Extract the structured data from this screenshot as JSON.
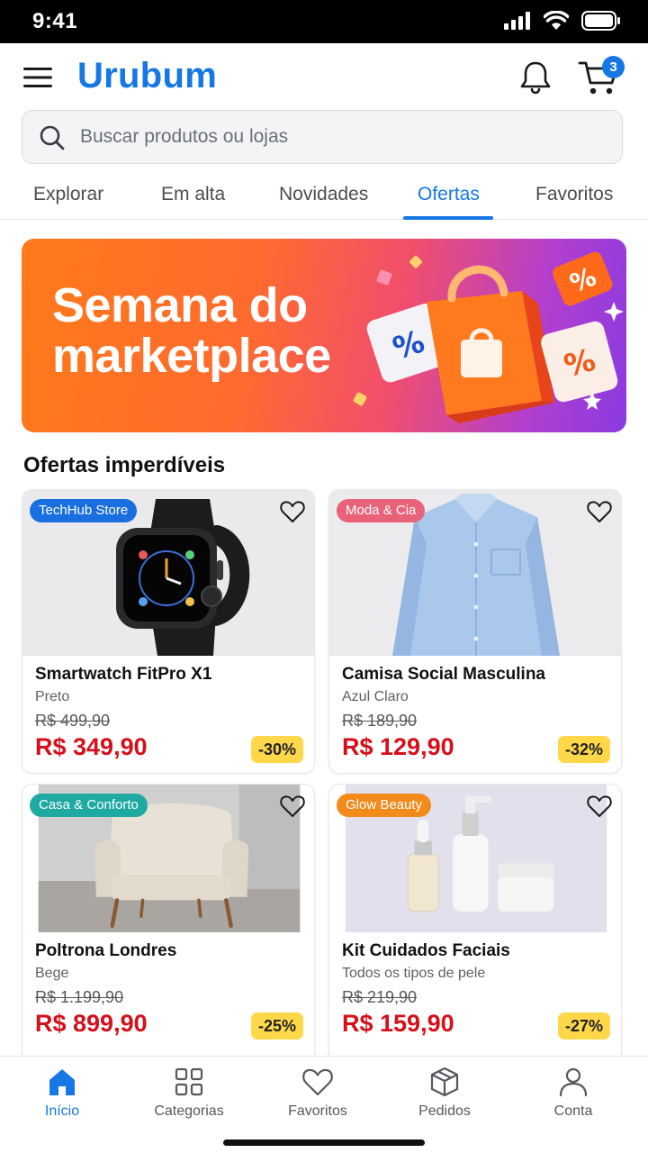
{
  "status_bar": {
    "time": "9:41"
  },
  "header": {
    "brand": "Urubum",
    "cart_count": "3"
  },
  "search": {
    "placeholder": "Buscar produtos ou lojas"
  },
  "tabs": [
    {
      "label": "Explorar"
    },
    {
      "label": "Em alta"
    },
    {
      "label": "Novidades"
    },
    {
      "label": "Ofertas",
      "active": true
    },
    {
      "label": "Favoritos"
    }
  ],
  "banner": {
    "title": "Semana do marketplace"
  },
  "section": {
    "title": "Ofertas imperdíveis"
  },
  "products": [
    {
      "store": "TechHub Store",
      "store_color": "#1a6fe0",
      "name": "Smartwatch FitPro X1",
      "variant": "Preto",
      "old_price": "R$ 499,90",
      "price": "R$ 349,90",
      "discount": "-30%"
    },
    {
      "store": "Moda & Cia",
      "store_color": "#e8637a",
      "name": "Camisa Social Masculina",
      "variant": "Azul Claro",
      "old_price": "R$ 189,90",
      "price": "R$ 129,90",
      "discount": "-32%"
    },
    {
      "store": "Casa & Conforto",
      "store_color": "#1fa9a3",
      "name": "Poltrona Londres",
      "variant": "Bege",
      "old_price": "R$ 1.199,90",
      "price": "R$ 899,90",
      "discount": "-25%"
    },
    {
      "store": "Glow Beauty",
      "store_color": "#f28a1c",
      "name": "Kit Cuidados Faciais",
      "variant": "Todos os tipos de pele",
      "old_price": "R$ 219,90",
      "price": "R$ 159,90",
      "discount": "-27%"
    }
  ],
  "bottom_nav": [
    {
      "label": "Início",
      "icon": "home-icon",
      "active": true
    },
    {
      "label": "Categorias",
      "icon": "grid-icon"
    },
    {
      "label": "Favoritos",
      "icon": "heart-icon"
    },
    {
      "label": "Pedidos",
      "icon": "box-icon"
    },
    {
      "label": "Conta",
      "icon": "user-icon"
    }
  ],
  "colors": {
    "accent": "#1677e5",
    "price": "#d6101b",
    "discount_bg": "#ffd84a"
  }
}
